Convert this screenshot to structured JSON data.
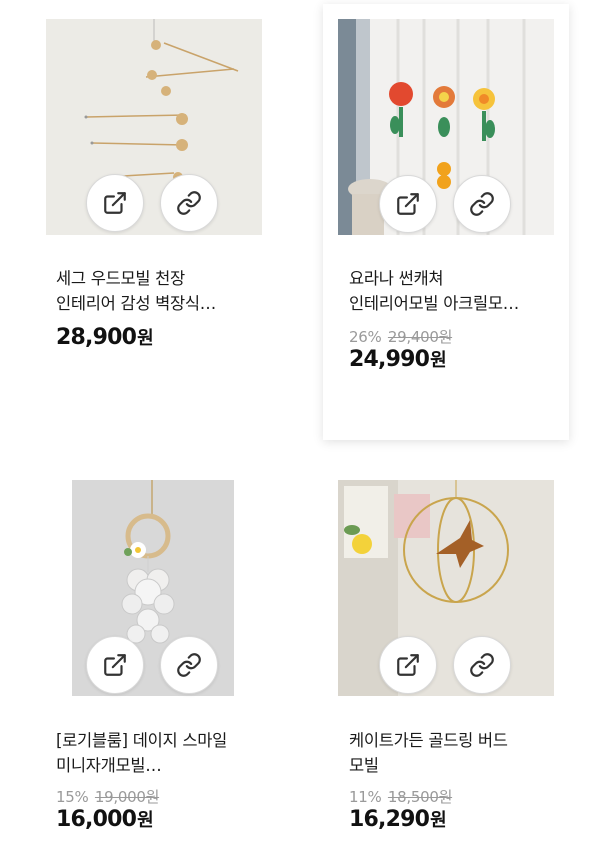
{
  "products": [
    {
      "title_line1": "세그 우드모빌 천장",
      "title_line2": "인테리어 감성 벽장식…",
      "discount": "",
      "original_price": "",
      "price": "28,900",
      "currency": "원",
      "share_icon": "external-link-icon",
      "link_icon": "link-icon"
    },
    {
      "title_line1": "요라나 썬캐쳐",
      "title_line2": "인테리어모빌 아크릴모…",
      "discount": "26%",
      "original_price": "29,400원",
      "price": "24,990",
      "currency": "원",
      "share_icon": "external-link-icon",
      "link_icon": "link-icon"
    },
    {
      "title_line1": "[로기블룸] 데이지 스마일",
      "title_line2": "미니자개모빌…",
      "discount": "15%",
      "original_price": "19,000원",
      "price": "16,000",
      "currency": "원",
      "share_icon": "external-link-icon",
      "link_icon": "link-icon"
    },
    {
      "title_line1": "케이트가든 골드링 버드",
      "title_line2": "모빌",
      "discount": "11%",
      "original_price": "18,500원",
      "price": "16,290",
      "currency": "원",
      "share_icon": "external-link-icon",
      "link_icon": "link-icon"
    }
  ]
}
